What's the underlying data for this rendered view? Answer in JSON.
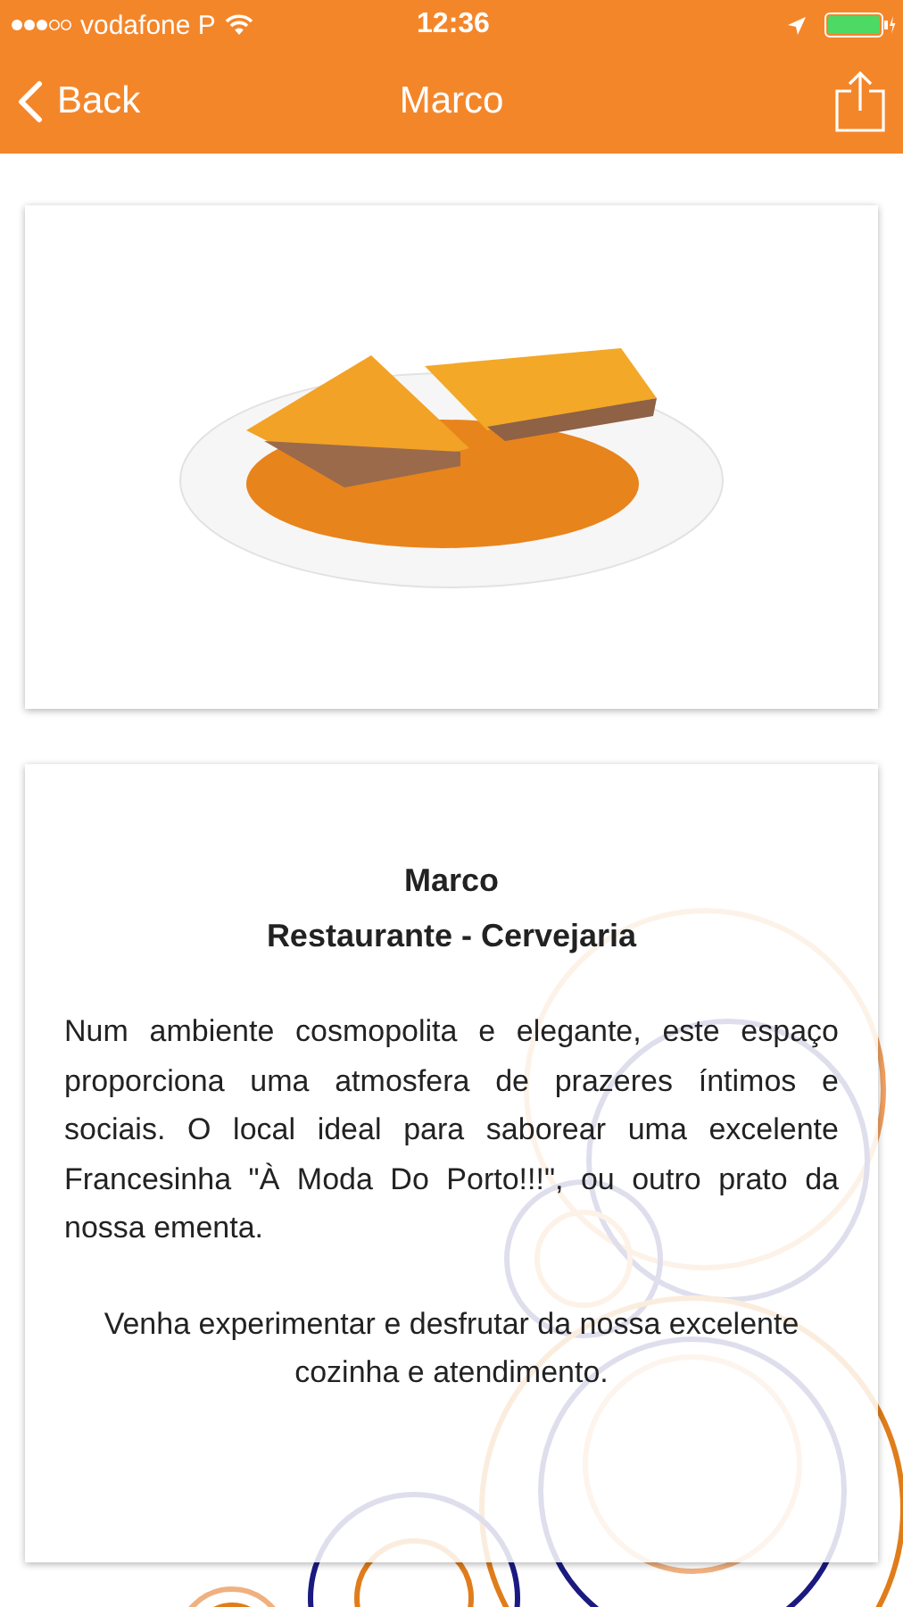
{
  "status_bar": {
    "carrier": "vodafone P",
    "time": "12:36"
  },
  "nav_bar": {
    "back": "Back",
    "title": "Marco"
  },
  "info_card": {
    "title": "Marco",
    "subtitle": "Restaurante - Cervejaria",
    "paragraphs": [
      "Num ambiente cosmopolita e elegante, este espaço proporciona uma atmosfera de prazeres íntimos e sociais. O local ideal para saborear uma excelente Francesinha \"À Moda Do Porto!!!\", ou outro prato da nossa ementa.",
      "Venha experimentar e desfrutar da nossa excelente cozinha e atendimento."
    ]
  }
}
